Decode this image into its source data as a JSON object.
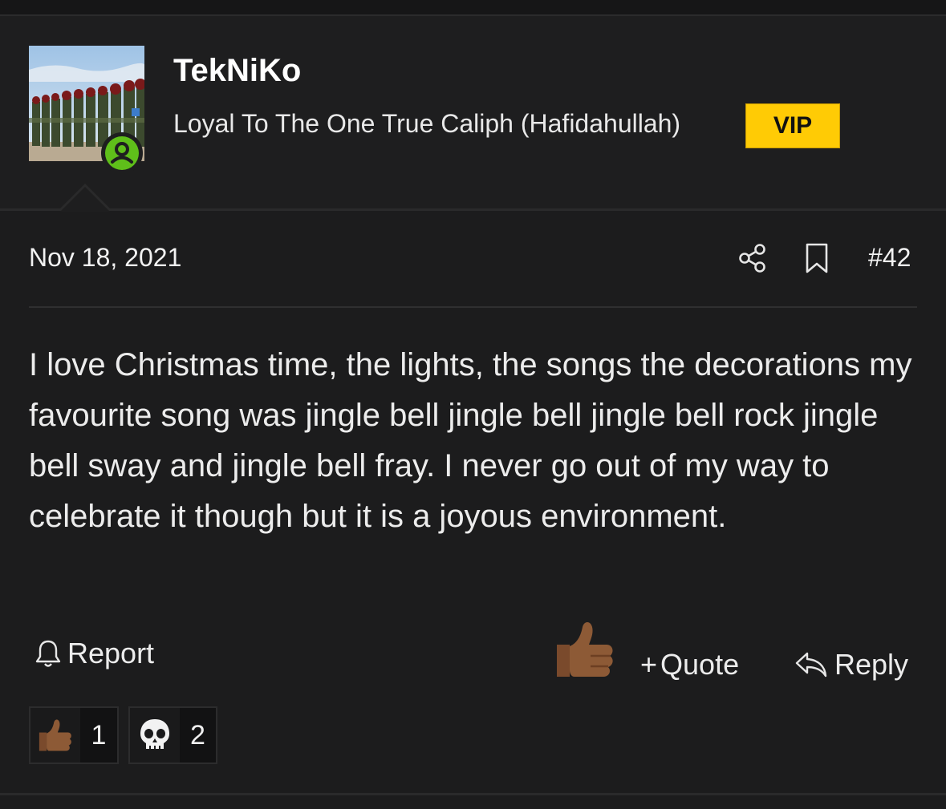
{
  "user": {
    "name": "TekNiKo",
    "title": "Loyal To The One True Caliph (Hafidahullah)",
    "badge": "VIP",
    "badge_color": "#ffcb05",
    "online_color": "#5fbf1a",
    "avatar_icon": "avatar-photo"
  },
  "post": {
    "date": "Nov 18, 2021",
    "number": "#42",
    "body": "I love Christmas time, the lights, the songs the decorations my favourite song was jingle bell jingle bell jingle bell rock jingle bell sway and jingle bell fray. I never go out of my way to celebrate it though but it is a joyous environment."
  },
  "actions": {
    "report_label": "Report",
    "quote_label": "Quote",
    "reply_label": "Reply",
    "share_icon": "share-icon",
    "bookmark_icon": "bookmark-icon",
    "like_icon": "thumbs-up-icon"
  },
  "reactions": [
    {
      "icon": "thumbs-up-icon",
      "count": "1"
    },
    {
      "icon": "skull-icon",
      "count": "2"
    }
  ]
}
